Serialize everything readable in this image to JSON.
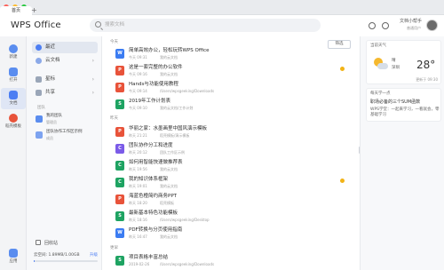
{
  "titlebar": {
    "tab_label": "首页",
    "new_tab": "+"
  },
  "header": {
    "app_name": "WPS Office",
    "search_placeholder": "搜索文档",
    "user_name": "文档小帮手",
    "user_sub": "普通用户"
  },
  "rail": {
    "items": [
      {
        "label": "新建",
        "color": "#5a8def"
      },
      {
        "label": "打开",
        "color": "#5a8def"
      },
      {
        "label": "文档",
        "color": "#4c7ef3"
      },
      {
        "label": "稻壳模板",
        "color": "#e8533a"
      },
      {
        "label": "应用",
        "color": "#5a8def"
      }
    ]
  },
  "nav": {
    "items": [
      {
        "label": "最近"
      },
      {
        "label": "云文档"
      },
      {
        "label": "星标"
      },
      {
        "label": "共享"
      }
    ],
    "team_section": "团队",
    "teams": [
      {
        "name": "我的团队",
        "sub": "管理员"
      },
      {
        "name": "团队协作工作区示例",
        "sub": "成员"
      }
    ],
    "recycle": "回收站",
    "storage_text": "云空间: 1.89MB/1.00GB",
    "storage_action": "升级",
    "storage_fraction": 0.02
  },
  "main": {
    "filter_label": "筛选",
    "groups": [
      "今天",
      "昨天",
      "更早"
    ],
    "files": [
      {
        "name": "简单高效办公，轻松玩转WPS Office",
        "time": "今天 09:31",
        "loc": "我的云文档",
        "type": "W",
        "color": "#3b7cf2",
        "starred": false
      },
      {
        "name": "这是一套完整的办公软件",
        "time": "今天 09:16",
        "loc": "我的云文档",
        "type": "P",
        "color": "#e8533a",
        "starred": true
      },
      {
        "name": "Hands与功能使用教程",
        "time": "今天 09:14",
        "loc": "/Users/wpsgeeking/Downloads",
        "type": "P",
        "color": "#e8533a",
        "starred": false
      },
      {
        "name": "2019年工作计划表",
        "time": "今天 09:10",
        "loc": "我的云文档/工作计划",
        "type": "S",
        "color": "#1ea362",
        "starred": false
      },
      {
        "name": "华丽之家：水墨画里中国风演示模板",
        "time": "昨天 21:21",
        "loc": "稻壳模板/演示模板",
        "type": "P",
        "color": "#e8533a",
        "starred": false
      },
      {
        "name": "团队协作分工和进度",
        "time": "昨天 20:12",
        "loc": "团队工作区示例",
        "type": "C",
        "color": "#7b5be8",
        "starred": false
      },
      {
        "name": "如何用智能快速做推荐表",
        "time": "昨天 19:56",
        "loc": "我的云文档",
        "type": "C",
        "color": "#1ea362",
        "starred": false
      },
      {
        "name": "我的知识体系框架",
        "time": "昨天 19:01",
        "loc": "我的云文档",
        "type": "C",
        "color": "#1ea362",
        "starred": true
      },
      {
        "name": "海蓝色橙简约商务PPT",
        "time": "昨天 18:20",
        "loc": "稻壳模板",
        "type": "P",
        "color": "#e8533a",
        "starred": false
      },
      {
        "name": "最新基本特色功能模板",
        "time": "昨天 18:16",
        "loc": "/Users/wpsgeeking/Desktop",
        "type": "S",
        "color": "#1ea362",
        "starred": false
      },
      {
        "name": "PDF转换与分页使用指南",
        "time": "昨天 16:47",
        "loc": "我的云文档",
        "type": "W",
        "color": "#3b7cf2",
        "starred": false
      },
      {
        "name": "项目表格丰富总结",
        "time": "2019-02-26",
        "loc": "/Users/wpsgeeking/Downloads",
        "type": "S",
        "color": "#1ea362",
        "starred": false
      }
    ]
  },
  "right": {
    "weather": {
      "head": "当前天气",
      "desc": "晴",
      "city": "深圳",
      "temp": "28°",
      "foot": "更新于 09:30"
    },
    "tip": {
      "head": "每天学一点",
      "title": "职场必备的三个SUM函数",
      "link": "WPS学堂：一起来学习，一看就会，零基础学习"
    }
  }
}
